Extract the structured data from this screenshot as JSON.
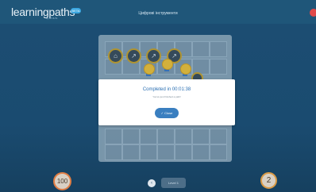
{
  "header": {
    "logo_text": "learningpaths",
    "logo_sub": "by BYJU'S",
    "badge": "BETA",
    "title": "Цифрові інструменти"
  },
  "board": {
    "chips": [
      {
        "icon": "home-icon",
        "glyph": "⌂"
      },
      {
        "icon": "arrow-icon",
        "glyph": "↗"
      },
      {
        "icon": "arrow-icon",
        "glyph": "↗"
      },
      {
        "icon": "arrow-icon",
        "glyph": "↗"
      }
    ],
    "medals": 3
  },
  "modal": {
    "title": "Completed in 00:01:38",
    "subtitle": "You've just finished a path!",
    "button": "✓ Close"
  },
  "footer": {
    "score_left": "100",
    "score_right": "2",
    "nav_label": "Level 1"
  },
  "colors": {
    "background": "#1a4a6e",
    "accent": "#3a7fc0",
    "medal": "#f2c233",
    "close_red": "#e04a4a"
  }
}
